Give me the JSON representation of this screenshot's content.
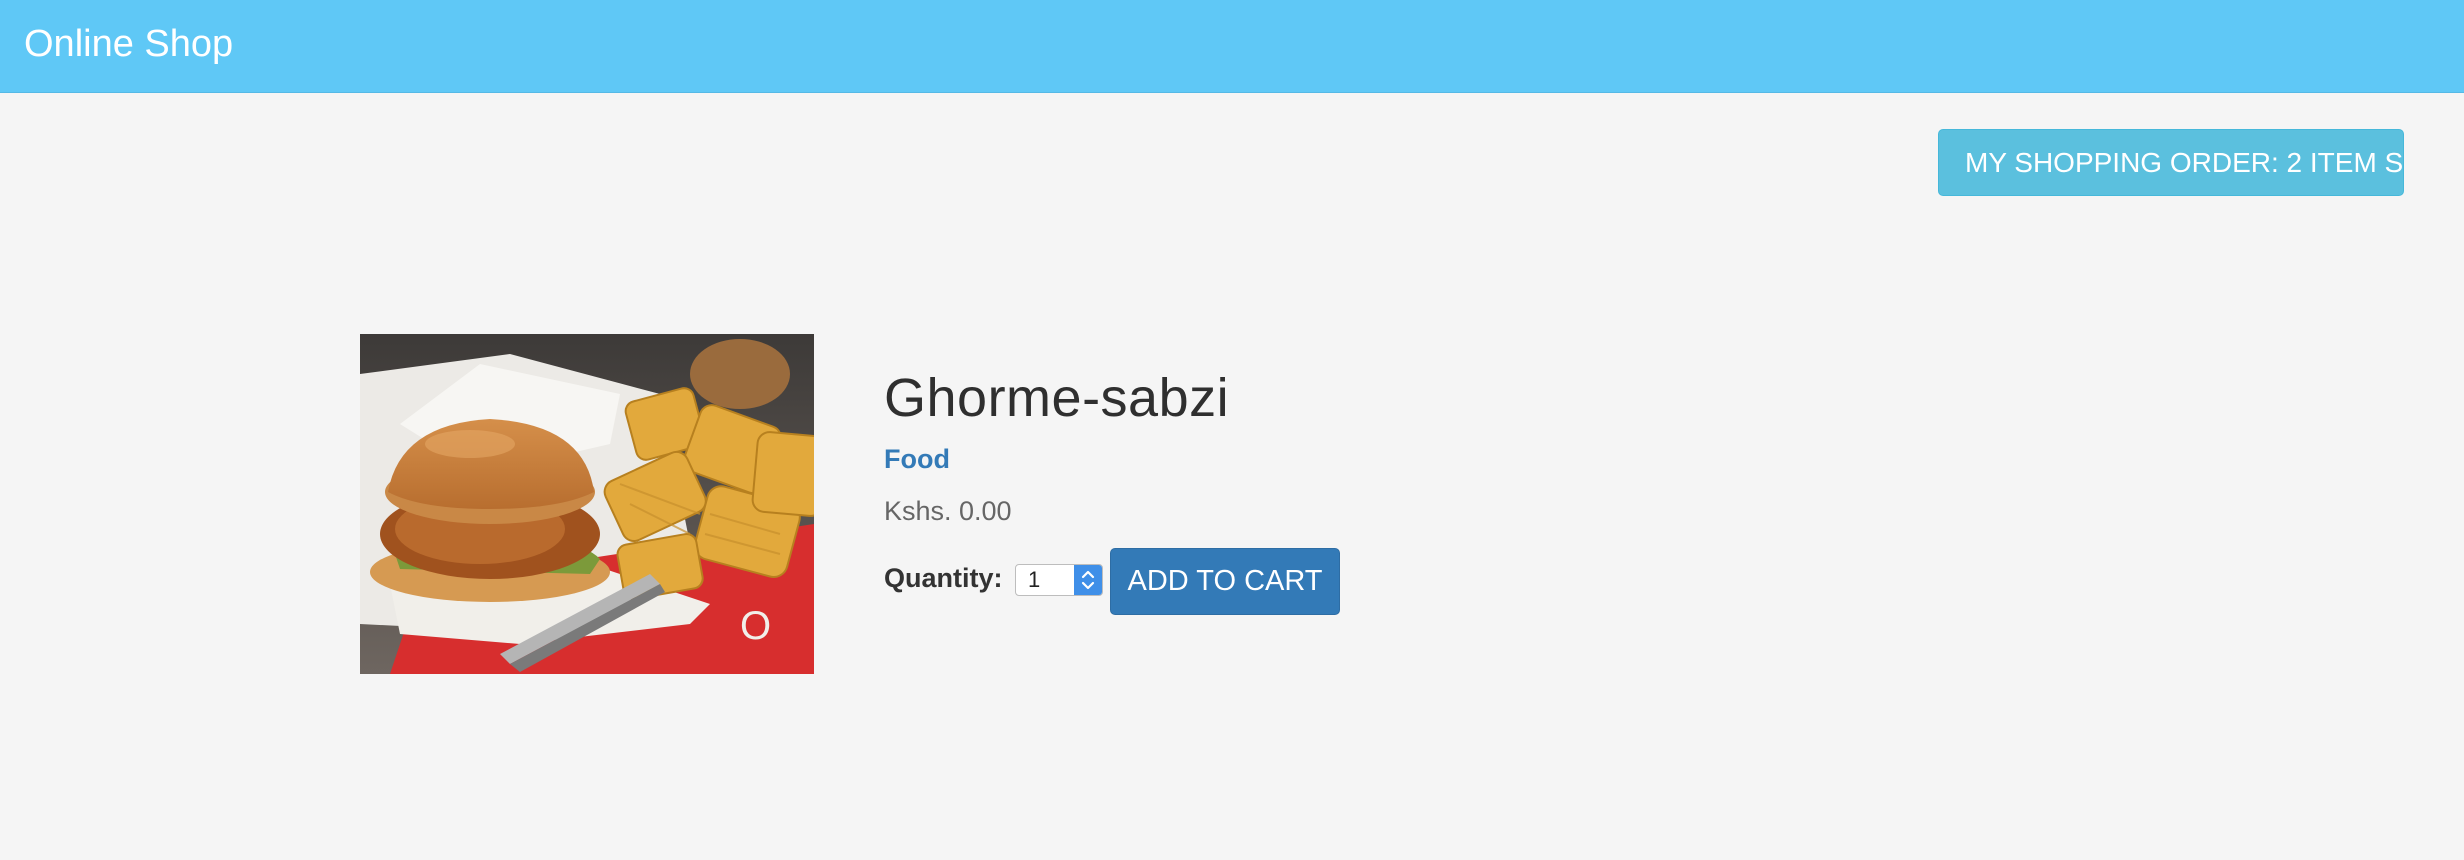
{
  "navbar": {
    "brand": "Online Shop"
  },
  "cart": {
    "order_label": "MY SHOPPING ORDER: 2 ITEM S"
  },
  "product": {
    "image_icon": "burger-and-waffle-fries-photo",
    "title": "Ghorme-sabzi",
    "category": "Food",
    "price": "Kshs. 0.00",
    "quantity_label": "Quantity:",
    "quantity_value": "1",
    "add_to_cart_label": "ADD TO CART"
  },
  "colors": {
    "navbar": "#5fc8f6",
    "page_background": "#f5f5f5",
    "order_button": "#5bc0de",
    "primary_button": "#337ab7",
    "category_link": "#337ab7"
  }
}
